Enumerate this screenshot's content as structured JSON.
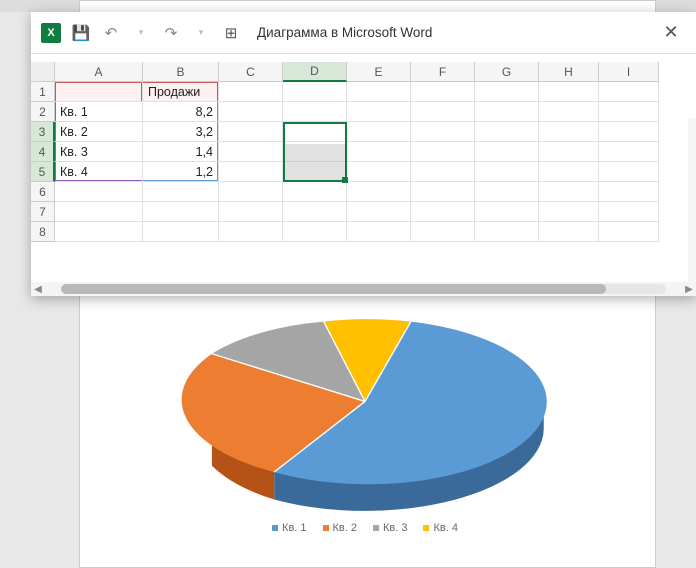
{
  "window": {
    "title": "Диаграмма в Microsoft Word"
  },
  "toolbar": {
    "excel": "X",
    "save": "💾",
    "undo": "↶",
    "redo": "↷",
    "table_icon": "⊞",
    "close": "✕"
  },
  "sheet": {
    "columns": [
      "A",
      "B",
      "C",
      "D",
      "E",
      "F",
      "G",
      "H",
      "I"
    ],
    "rows": [
      "1",
      "2",
      "3",
      "4",
      "5",
      "6",
      "7",
      "8"
    ],
    "header_b": "Продажи",
    "a2": "Кв. 1",
    "b2": "8,2",
    "a3": "Кв. 2",
    "b3": "3,2",
    "a4": "Кв. 3",
    "b4": "1,4",
    "a5": "Кв. 4",
    "b5": "1,2",
    "selected_cell": "D3:D5"
  },
  "legend": {
    "l1": "Кв. 1",
    "l2": "Кв. 2",
    "l3": "Кв. 3",
    "l4": "Кв. 4"
  },
  "colors": {
    "s1": "#5b9bd5",
    "s2": "#ed7d31",
    "s3": "#a5a5a5",
    "s4": "#ffc000"
  },
  "chart_data": {
    "type": "pie",
    "title": "",
    "categories": [
      "Кв. 1",
      "Кв. 2",
      "Кв. 3",
      "Кв. 4"
    ],
    "values": [
      8.2,
      3.2,
      1.4,
      1.2
    ],
    "series_name": "Продажи",
    "colors": [
      "#5b9bd5",
      "#ed7d31",
      "#a5a5a5",
      "#ffc000"
    ]
  }
}
